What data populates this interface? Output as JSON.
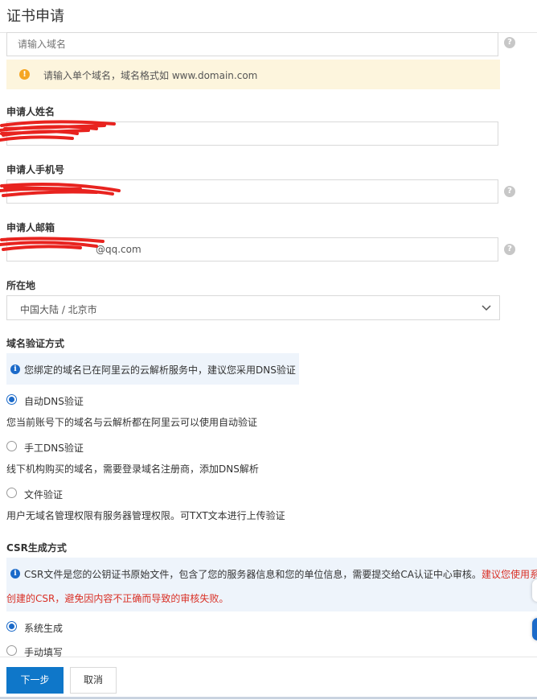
{
  "header": {
    "title": "证书申请"
  },
  "domain": {
    "placeholder": "请输入域名",
    "warning": "请输入单个域名，域名格式如 www.domain.com"
  },
  "applicant_name": {
    "label": "申请人姓名",
    "value": ""
  },
  "applicant_phone": {
    "label": "申请人手机号",
    "value": ""
  },
  "applicant_email": {
    "label": "申请人邮箱",
    "value": "@qq.com"
  },
  "location": {
    "label": "所在地",
    "value": "中国大陆 / 北京市"
  },
  "verify": {
    "label": "域名验证方式",
    "info": "您绑定的域名已在阿里云的云解析服务中，建议您采用DNS验证",
    "options": [
      {
        "label": "自动DNS验证",
        "desc": "您当前账号下的域名与云解析都在阿里云可以使用自动验证",
        "checked": true
      },
      {
        "label": "手工DNS验证",
        "desc": "线下机构购买的域名，需要登录域名注册商，添加DNS解析",
        "checked": false
      },
      {
        "label": "文件验证",
        "desc": "用户无域名管理权限有服务器管理权限。可TXT文本进行上传验证",
        "checked": false
      }
    ]
  },
  "csr": {
    "label": "CSR生成方式",
    "info_black": "CSR文件是您的公钥证书原始文件，包含了您的服务器信息和您的单位信息，需要提交给CA认证中心审核。",
    "info_red_1": "建议您使用系统",
    "info_red_2": "创建的CSR，避免因内容不正确而导致的审核失败。",
    "options": [
      {
        "label": "系统生成",
        "checked": true
      },
      {
        "label": "手动填写",
        "checked": false
      }
    ]
  },
  "footer": {
    "next_label": "下一步",
    "cancel_label": "取消"
  },
  "help_icon": "?",
  "colors": {
    "primary": "#0f77c9",
    "warning_bg": "#fdf5dd",
    "info_bg": "#eef4fb",
    "red": "#d93026"
  }
}
